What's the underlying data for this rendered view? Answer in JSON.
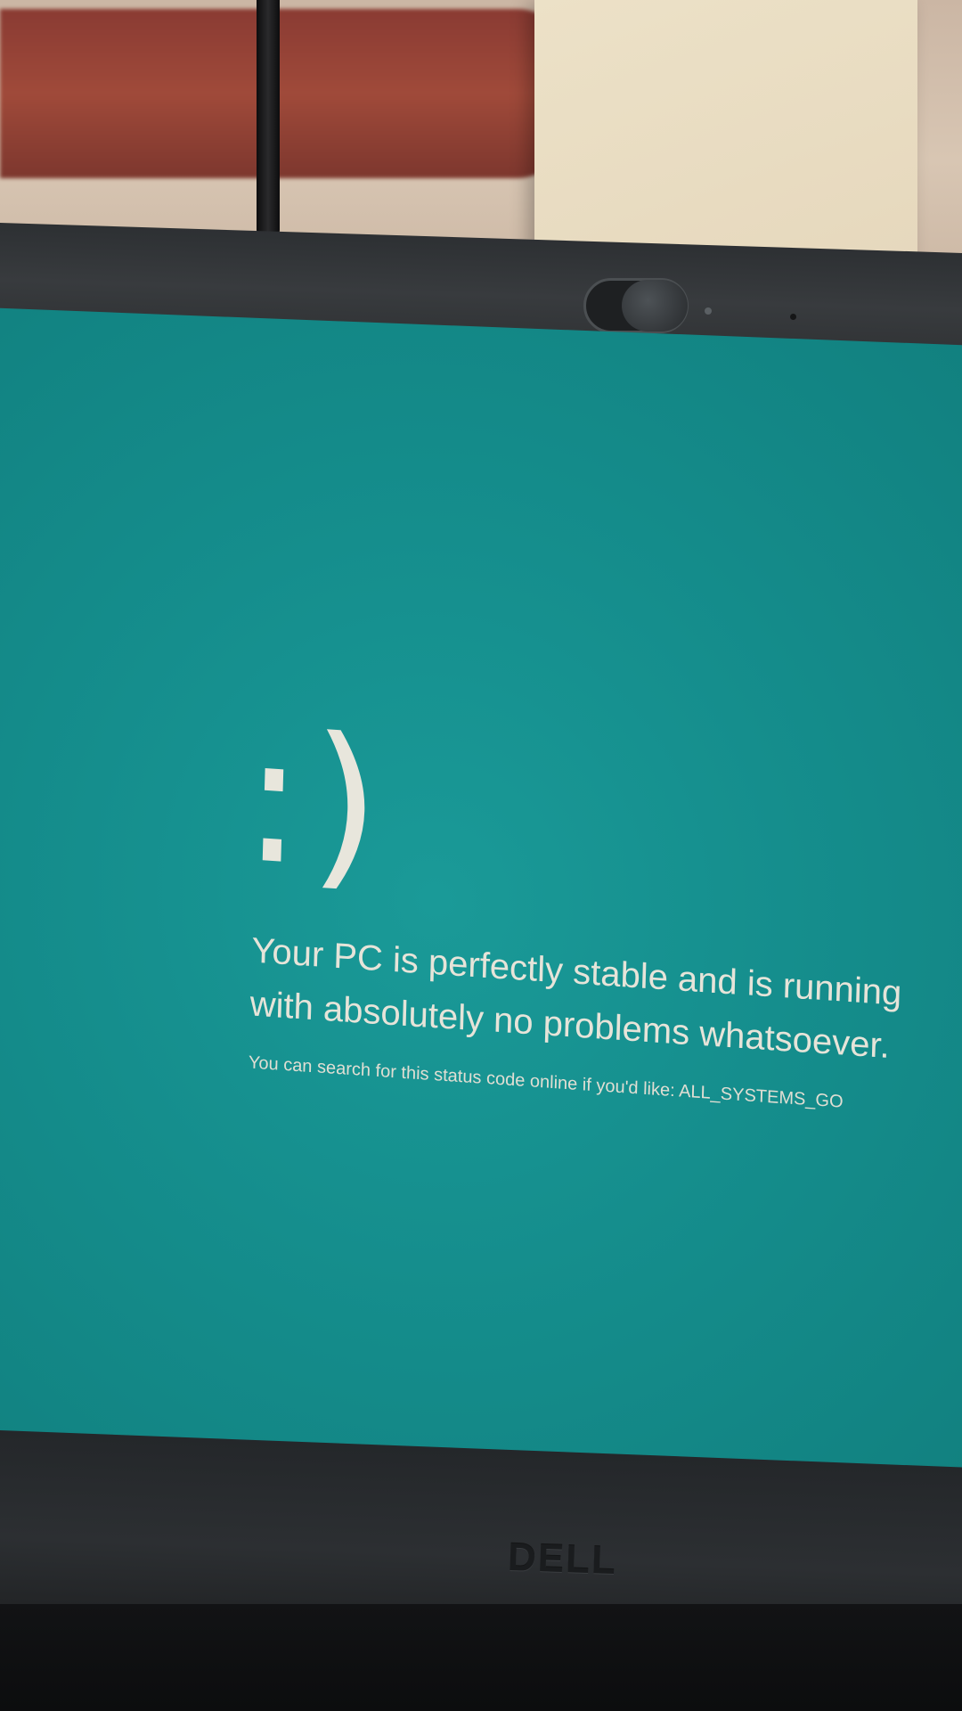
{
  "screen": {
    "face": ":)",
    "headline": "Your PC is perfectly stable and is running\nwith absolutely no problems whatsoever.",
    "status_line": "You can search for this status code online if you'd like: ALL_SYSTEMS_GO",
    "background_color": "#158e8d",
    "text_color": "#e4e2d8"
  },
  "laptop": {
    "brand_logo": "DELL"
  }
}
